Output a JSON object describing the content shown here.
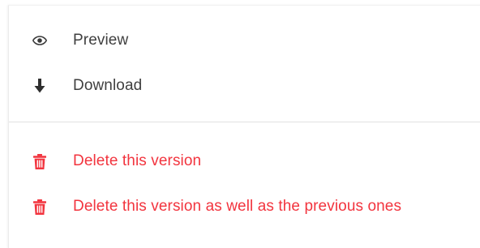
{
  "menu": {
    "items": [
      {
        "label": "Preview",
        "icon": "eye-icon",
        "variant": "neutral"
      },
      {
        "label": "Download",
        "icon": "download-arrow-icon",
        "variant": "neutral"
      },
      {
        "label": "Delete this version",
        "icon": "trash-icon",
        "variant": "danger"
      },
      {
        "label": "Delete this version as well as the previous ones",
        "icon": "trash-icon",
        "variant": "danger"
      }
    ]
  },
  "colors": {
    "neutral_text": "#3f3f3f",
    "danger": "#f2343e",
    "divider": "#e1e1e1"
  }
}
